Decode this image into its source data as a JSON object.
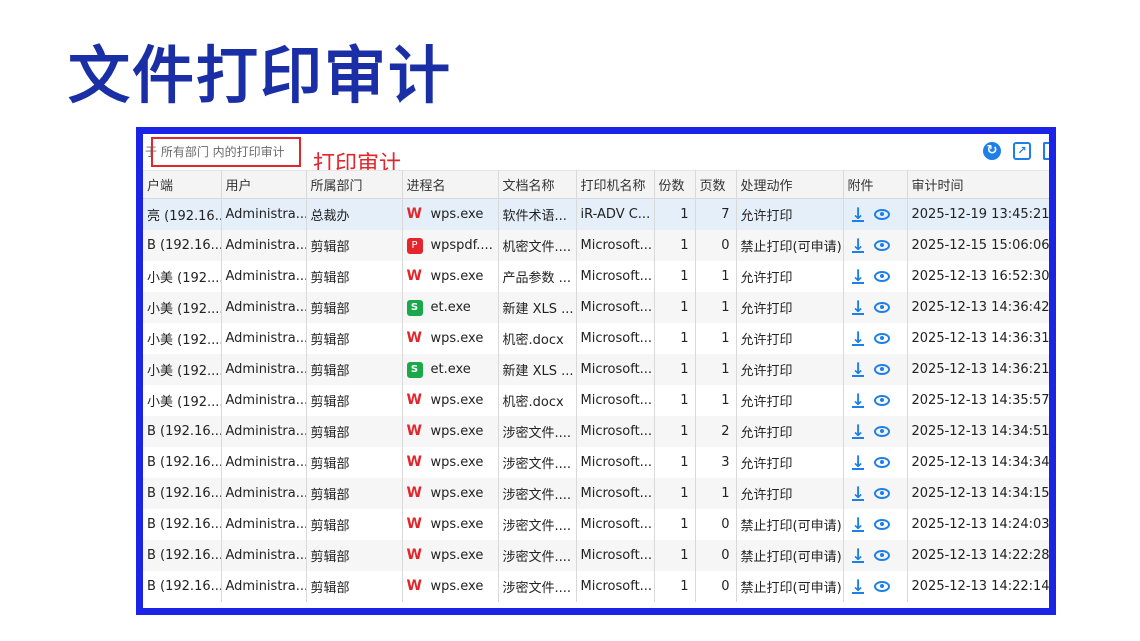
{
  "page": {
    "title": "文件打印审计"
  },
  "toolbar": {
    "scope_text": "于 所有部门 内的打印审计",
    "annotation": "打印审计",
    "accent_color": "#1e7fe6",
    "icons": [
      "refresh-icon",
      "export-icon",
      "more-icon"
    ]
  },
  "table": {
    "headers": [
      "户端",
      "用户",
      "所属部门",
      "进程名",
      "文档名称",
      "打印机名称",
      "份数",
      "页数",
      "处理动作",
      "附件",
      "审计时间"
    ],
    "rows": [
      {
        "client": "亮 (192.16...",
        "user": "Administra...",
        "dept": "总裁办",
        "process": "wps.exe",
        "process_icon": "wps",
        "doc": "软件术语...",
        "printer": "iR-ADV C...",
        "copies": "1",
        "pages": "7",
        "action": "允许打印",
        "time": "2025-12-19 13:45:21"
      },
      {
        "client": "B (192.16...",
        "user": "Administra...",
        "dept": "剪辑部",
        "process": "wpspdf....",
        "process_icon": "pdf",
        "doc": "机密文件....",
        "printer": "Microsoft...",
        "copies": "1",
        "pages": "0",
        "action": "禁止打印(可申请)",
        "time": "2025-12-15 15:06:06"
      },
      {
        "client": "小美 (192....",
        "user": "Administra...",
        "dept": "剪辑部",
        "process": "wps.exe",
        "process_icon": "wps",
        "doc": "产品参数 ...",
        "printer": "Microsoft...",
        "copies": "1",
        "pages": "1",
        "action": "允许打印",
        "time": "2025-12-13 16:52:30"
      },
      {
        "client": "小美 (192....",
        "user": "Administra...",
        "dept": "剪辑部",
        "process": "et.exe",
        "process_icon": "et",
        "doc": "新建 XLS ...",
        "printer": "Microsoft...",
        "copies": "1",
        "pages": "1",
        "action": "允许打印",
        "time": "2025-12-13 14:36:42"
      },
      {
        "client": "小美 (192....",
        "user": "Administra...",
        "dept": "剪辑部",
        "process": "wps.exe",
        "process_icon": "wps",
        "doc": "机密.docx",
        "printer": "Microsoft...",
        "copies": "1",
        "pages": "1",
        "action": "允许打印",
        "time": "2025-12-13 14:36:31"
      },
      {
        "client": "小美 (192....",
        "user": "Administra...",
        "dept": "剪辑部",
        "process": "et.exe",
        "process_icon": "et",
        "doc": "新建 XLS ...",
        "printer": "Microsoft...",
        "copies": "1",
        "pages": "1",
        "action": "允许打印",
        "time": "2025-12-13 14:36:21"
      },
      {
        "client": "小美 (192....",
        "user": "Administra...",
        "dept": "剪辑部",
        "process": "wps.exe",
        "process_icon": "wps",
        "doc": "机密.docx",
        "printer": "Microsoft...",
        "copies": "1",
        "pages": "1",
        "action": "允许打印",
        "time": "2025-12-13 14:35:57"
      },
      {
        "client": "B (192.16...",
        "user": "Administra...",
        "dept": "剪辑部",
        "process": "wps.exe",
        "process_icon": "wps",
        "doc": "涉密文件....",
        "printer": "Microsoft...",
        "copies": "1",
        "pages": "2",
        "action": "允许打印",
        "time": "2025-12-13 14:34:51"
      },
      {
        "client": "B (192.16...",
        "user": "Administra...",
        "dept": "剪辑部",
        "process": "wps.exe",
        "process_icon": "wps",
        "doc": "涉密文件....",
        "printer": "Microsoft...",
        "copies": "1",
        "pages": "3",
        "action": "允许打印",
        "time": "2025-12-13 14:34:34"
      },
      {
        "client": "B (192.16...",
        "user": "Administra...",
        "dept": "剪辑部",
        "process": "wps.exe",
        "process_icon": "wps",
        "doc": "涉密文件....",
        "printer": "Microsoft...",
        "copies": "1",
        "pages": "1",
        "action": "允许打印",
        "time": "2025-12-13 14:34:15"
      },
      {
        "client": "B (192.16...",
        "user": "Administra...",
        "dept": "剪辑部",
        "process": "wps.exe",
        "process_icon": "wps",
        "doc": "涉密文件....",
        "printer": "Microsoft...",
        "copies": "1",
        "pages": "0",
        "action": "禁止打印(可申请)",
        "time": "2025-12-13 14:24:03"
      },
      {
        "client": "B (192.16...",
        "user": "Administra...",
        "dept": "剪辑部",
        "process": "wps.exe",
        "process_icon": "wps",
        "doc": "涉密文件....",
        "printer": "Microsoft...",
        "copies": "1",
        "pages": "0",
        "action": "禁止打印(可申请)",
        "time": "2025-12-13 14:22:28"
      },
      {
        "client": "B (192.16...",
        "user": "Administra...",
        "dept": "剪辑部",
        "process": "wps.exe",
        "process_icon": "wps",
        "doc": "涉密文件....",
        "printer": "Microsoft...",
        "copies": "1",
        "pages": "0",
        "action": "禁止打印(可申请)",
        "time": "2025-12-13 14:22:14"
      }
    ]
  }
}
